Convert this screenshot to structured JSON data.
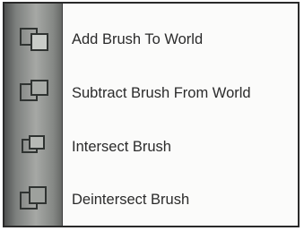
{
  "menu": {
    "items": [
      {
        "label": "Add Brush To World",
        "icon": "brush-add-icon"
      },
      {
        "label": "Subtract Brush From World",
        "icon": "brush-subtract-icon"
      },
      {
        "label": "Intersect Brush",
        "icon": "brush-intersect-icon"
      },
      {
        "label": "Deintersect Brush",
        "icon": "brush-deintersect-icon"
      }
    ]
  },
  "colors": {
    "icon_column": "#8f918e",
    "menu_background": "#fbfbfa",
    "border": "#2a2a2a",
    "text": "#2b2b2b"
  }
}
